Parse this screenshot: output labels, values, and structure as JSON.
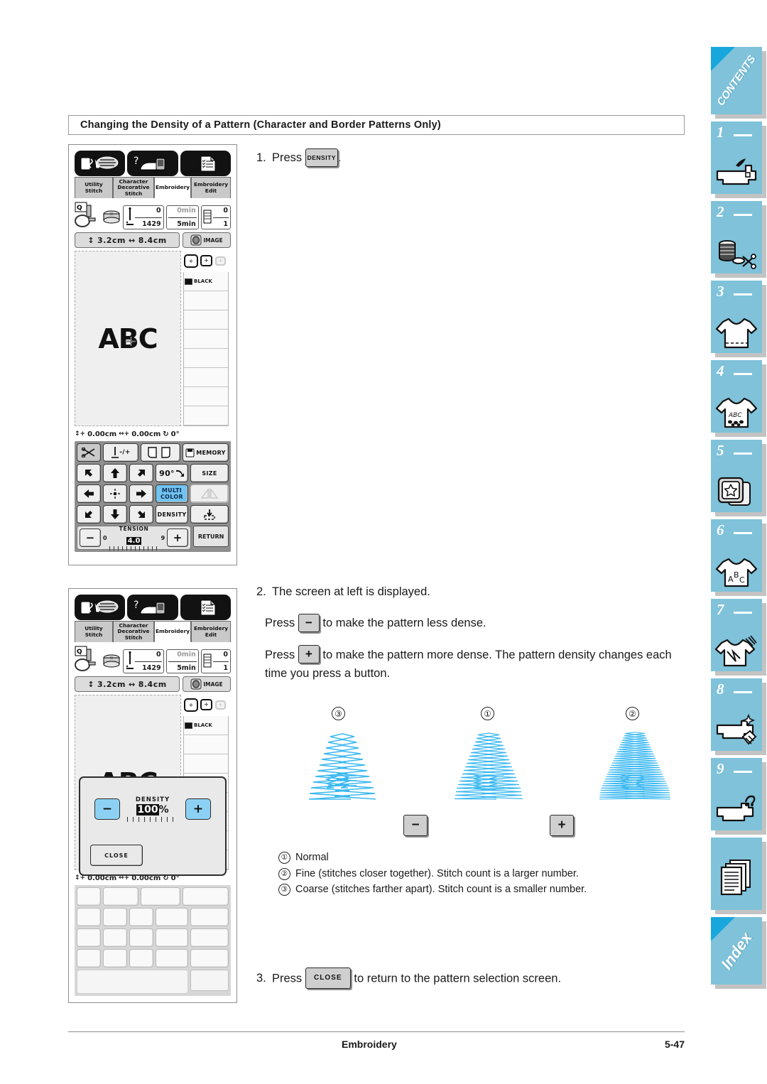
{
  "heading": "Changing the Density of a Pattern (Character and Border Patterns Only)",
  "steps": {
    "s1_num": "1.",
    "s1_press": "Press",
    "s1_button": "DENSITY",
    "s1_period": ".",
    "s2_num": "2.",
    "s2_line1": "The screen at left is displayed.",
    "s2_press_a": "Press",
    "s2_btn_minus": "−",
    "s2_text_a": "to make the pattern less dense.",
    "s2_press_b": "Press",
    "s2_btn_plus": "+",
    "s2_text_b": "to make the pattern more dense. The pattern density changes each time you press a button.",
    "s3_num": "3.",
    "s3_press": "Press",
    "s3_button": "CLOSE",
    "s3_text": "to return to the pattern selection screen."
  },
  "figure": {
    "marks": [
      "③",
      "①",
      "②"
    ],
    "minus_label": "−",
    "plus_label": "+",
    "densities": [
      "coarse",
      "normal",
      "fine"
    ]
  },
  "legend": [
    {
      "num": "①",
      "text": "Normal"
    },
    {
      "num": "②",
      "text": "Fine (stitches closer together). Stitch count is a larger number."
    },
    {
      "num": "③",
      "text": "Coarse (stitches farther apart). Stitch count is a smaller number."
    }
  ],
  "lcd": {
    "tabs": [
      "Utility Stitch",
      "Character Decorative Stitch",
      "Embroidery",
      "Embroidery Edit"
    ],
    "tab_lines": {
      "t1a": "Utility",
      "t1b": "Stitch",
      "t2a": "Character",
      "t2b": "Decorative",
      "t2c": "Stitch",
      "t3a": "Embroidery",
      "t4a": "Embroidery",
      "t4b": "Edit"
    },
    "info": {
      "stitch_top": "0",
      "stitch_bottom": "1429",
      "time_top": "0min",
      "time_bottom": "5min",
      "color_top": "0",
      "color_bottom": "1"
    },
    "size": {
      "height": "3.2cm",
      "width": "8.4cm",
      "image_label": "IMAGE"
    },
    "preview_text": "ABC",
    "color_name": "BLACK",
    "coords": {
      "vert": "0.00cm",
      "horz": "0.00cm",
      "rot": "0°"
    },
    "keys": {
      "rotate90": "90°",
      "memory": "MEMORY",
      "size": "SIZE",
      "multicolor_a": "MULTI",
      "multicolor_b": "COLOR",
      "density": "DENSITY",
      "tension_label": "TENSION",
      "tension_min": "0",
      "tension_value": "4.0",
      "tension_max": "9",
      "tension_minus": "−",
      "tension_plus": "+",
      "return": "RETURN",
      "needle_pm": "-/+"
    },
    "dialog": {
      "label": "DENSITY",
      "value": "100",
      "unit": "%",
      "minus": "−",
      "plus": "+",
      "close": "CLOSE"
    }
  },
  "footer": {
    "section": "Embroidery",
    "page": "5-47"
  },
  "nav": {
    "contents": "CONTENTS",
    "index": "Index",
    "chapters": [
      "1",
      "2",
      "3",
      "4",
      "5",
      "6",
      "7",
      "8",
      "9"
    ],
    "icons": [
      "sewing-machine",
      "thread-spool",
      "tshirt-plain",
      "tshirt-abc",
      "embroidery-card",
      "tshirt-letters",
      "tshirt-applique",
      "machine-sparkle",
      "machine-question",
      "appendix-pages"
    ]
  },
  "colors": {
    "nav_tab": "#7fc2da",
    "nav_corner": "#17a7dc",
    "stitch_blue": "#3bb8f0",
    "key_blue": "#72c3ef",
    "dialog_btn": "#8cd1f3"
  }
}
